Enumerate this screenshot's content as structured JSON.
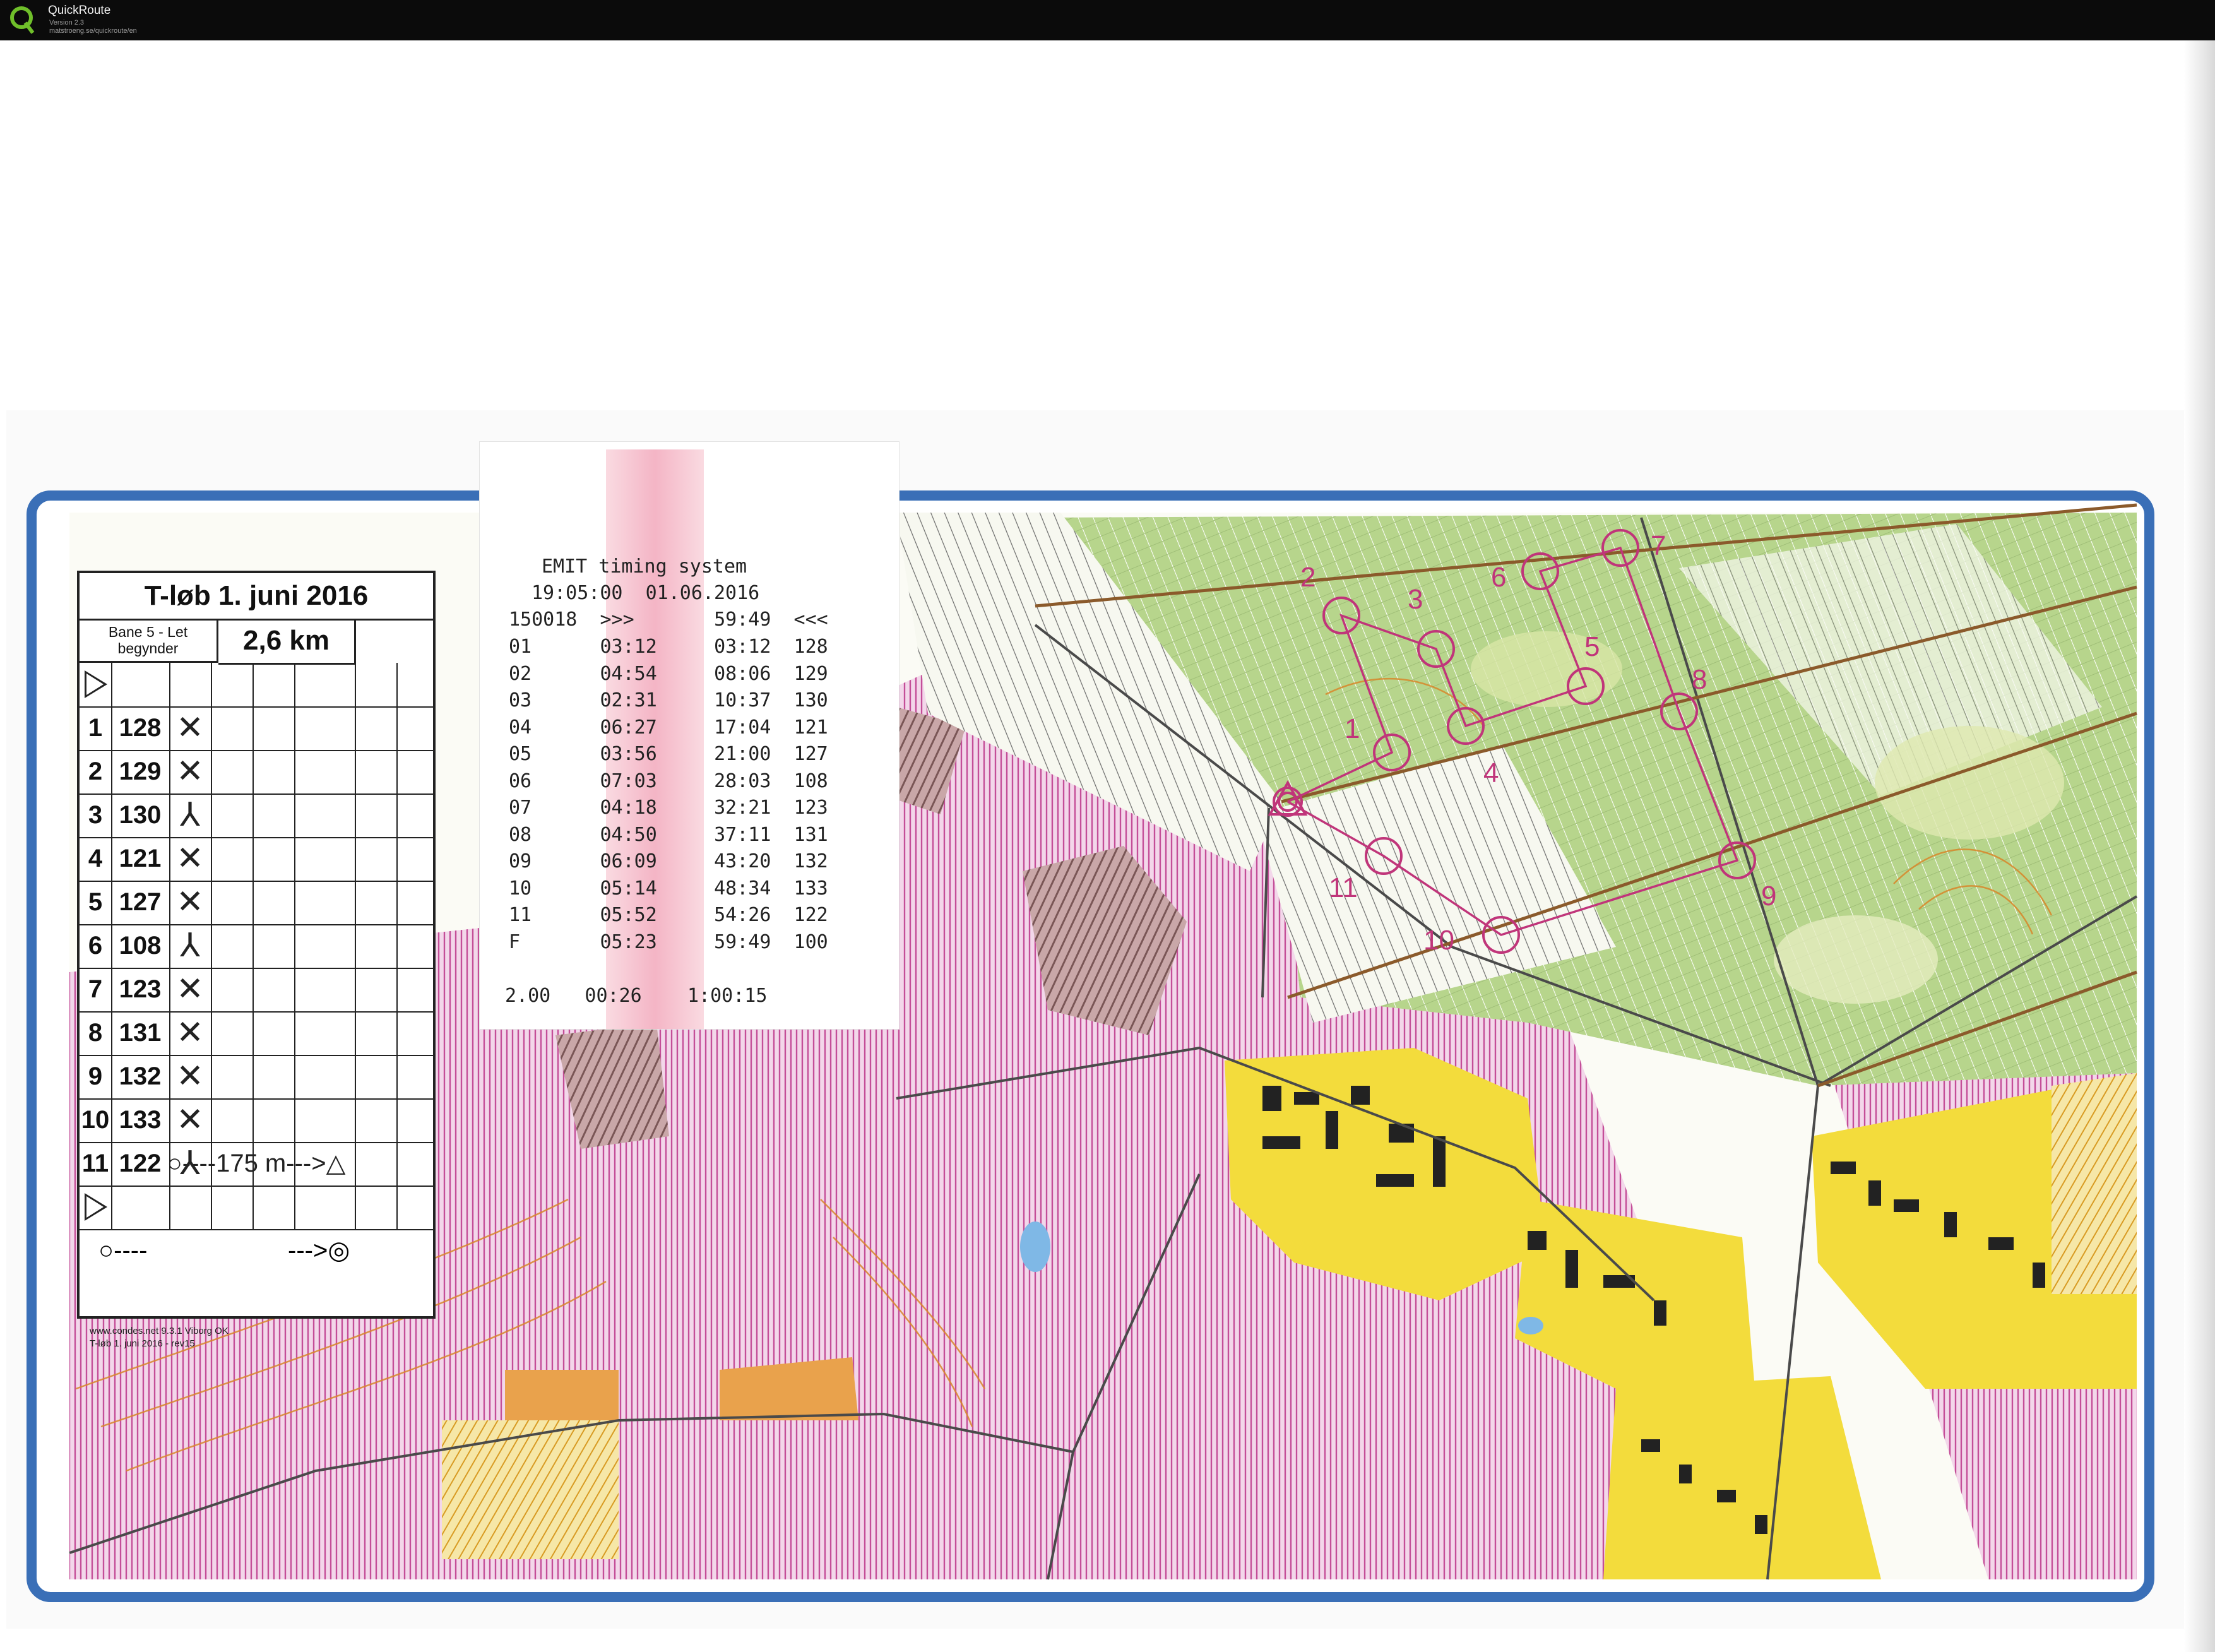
{
  "app": {
    "title": "QuickRoute",
    "version": "Version 2.3",
    "url": "matstroeng.se/quickroute/en"
  },
  "card": {
    "title": "T-løb 1. juni 2016",
    "course_line1": "Bane 5 - Let",
    "course_line2": "begynder",
    "length": "2,6 km",
    "controls": [
      {
        "num": "1",
        "code": "128",
        "mark": "✕"
      },
      {
        "num": "2",
        "code": "129",
        "mark": "✕"
      },
      {
        "num": "3",
        "code": "130",
        "mark": "⅄"
      },
      {
        "num": "4",
        "code": "121",
        "mark": "✕"
      },
      {
        "num": "5",
        "code": "127",
        "mark": "✕"
      },
      {
        "num": "6",
        "code": "108",
        "mark": "⅄"
      },
      {
        "num": "7",
        "code": "123",
        "mark": "✕"
      },
      {
        "num": "8",
        "code": "131",
        "mark": "✕"
      },
      {
        "num": "9",
        "code": "132",
        "mark": "✕"
      },
      {
        "num": "10",
        "code": "133",
        "mark": "✕"
      },
      {
        "num": "11",
        "code": "122",
        "mark": "⅄"
      }
    ],
    "finish_line": "○----175 m--->△",
    "bottom_left": "○----",
    "bottom_right": "--->◎",
    "footer1": "www.condes.net 9.3.1 Viborg OK",
    "footer2": "T-løb 1. juni 2016 - rev15"
  },
  "emit": {
    "title": "EMIT timing system",
    "datetime": "19:05:00  01.06.2016",
    "header": "150018  >>>       59:49  <<<",
    "rows": [
      "01      03:12     03:12  128",
      "02      04:54     08:06  129",
      "03      02:31     10:37  130",
      "04      06:27     17:04  121",
      "05      03:56     21:00  127",
      "06      07:03     28:03  108",
      "07      04:18     32:21  123",
      "08      04:50     37:11  131",
      "09      06:09     43:20  132",
      "10      05:14     48:34  133",
      "11      05:52     54:26  122",
      "F       05:23     59:49  100"
    ],
    "footer": "2.00   00:26    1:00:15"
  },
  "map": {
    "controls": [
      "1",
      "2",
      "3",
      "4",
      "5",
      "6",
      "7",
      "8",
      "9",
      "10",
      "11"
    ],
    "colors": {
      "border": "#3a6fb7",
      "course": "#c0357a",
      "green": "#9cc46a",
      "yellow": "#f3dc3c",
      "pink": "#d879b8"
    }
  }
}
